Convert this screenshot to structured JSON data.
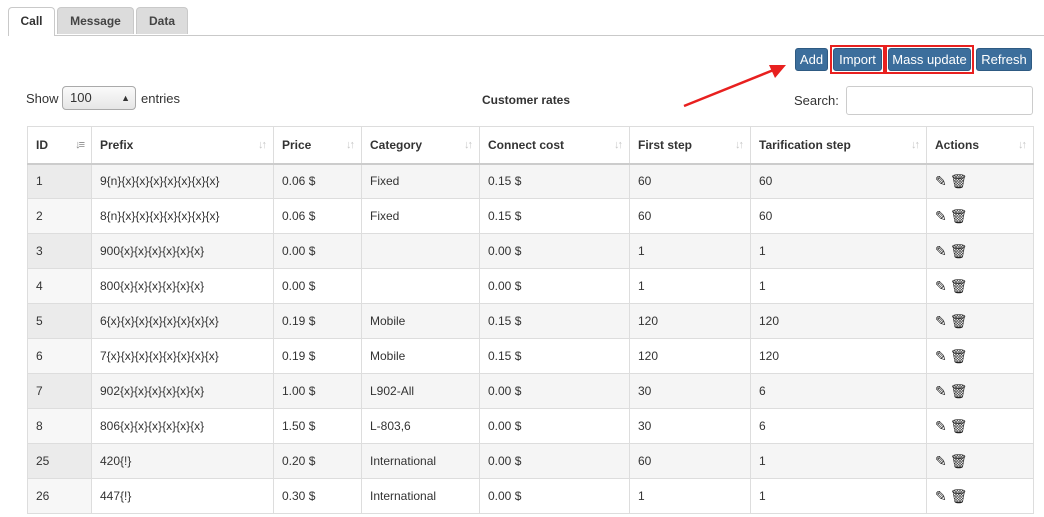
{
  "tabs": [
    {
      "label": "Call",
      "active": true
    },
    {
      "label": "Message",
      "active": false
    },
    {
      "label": "Data",
      "active": false
    }
  ],
  "toolbar": {
    "add_label": "Add",
    "import_label": "Import",
    "mass_update_label": "Mass update",
    "refresh_label": "Refresh",
    "highlight_color": "#e8201f"
  },
  "controls": {
    "show_label": "Show",
    "entries_value": "100",
    "entries_label": "entries",
    "table_title": "Customer rates",
    "search_label": "Search:",
    "search_value": ""
  },
  "table": {
    "columns": [
      "ID",
      "Prefix",
      "Price",
      "Category",
      "Connect cost",
      "First step",
      "Tarification step",
      "Actions"
    ],
    "rows": [
      {
        "id": "1",
        "prefix": "9{n}{x}{x}{x}{x}{x}{x}{x}",
        "price": "0.06 $",
        "category": "Fixed",
        "connect_cost": "0.15 $",
        "first_step": "60",
        "tariff_step": "60"
      },
      {
        "id": "2",
        "prefix": "8{n}{x}{x}{x}{x}{x}{x}{x}",
        "price": "0.06 $",
        "category": "Fixed",
        "connect_cost": "0.15 $",
        "first_step": "60",
        "tariff_step": "60"
      },
      {
        "id": "3",
        "prefix": "900{x}{x}{x}{x}{x}{x}",
        "price": "0.00 $",
        "category": "",
        "connect_cost": "0.00 $",
        "first_step": "1",
        "tariff_step": "1"
      },
      {
        "id": "4",
        "prefix": "800{x}{x}{x}{x}{x}{x}",
        "price": "0.00 $",
        "category": "",
        "connect_cost": "0.00 $",
        "first_step": "1",
        "tariff_step": "1"
      },
      {
        "id": "5",
        "prefix": "6{x}{x}{x}{x}{x}{x}{x}{x}",
        "price": "0.19 $",
        "category": "Mobile",
        "connect_cost": "0.15 $",
        "first_step": "120",
        "tariff_step": "120"
      },
      {
        "id": "6",
        "prefix": "7{x}{x}{x}{x}{x}{x}{x}{x}",
        "price": "0.19 $",
        "category": "Mobile",
        "connect_cost": "0.15 $",
        "first_step": "120",
        "tariff_step": "120"
      },
      {
        "id": "7",
        "prefix": "902{x}{x}{x}{x}{x}{x}",
        "price": "1.00 $",
        "category": "L902-All",
        "connect_cost": "0.00 $",
        "first_step": "30",
        "tariff_step": "6"
      },
      {
        "id": "8",
        "prefix": "806{x}{x}{x}{x}{x}{x}",
        "price": "1.50 $",
        "category": "L-803,6",
        "connect_cost": "0.00 $",
        "first_step": "30",
        "tariff_step": "6"
      },
      {
        "id": "25",
        "prefix": "420{!}",
        "price": "0.20 $",
        "category": "International",
        "connect_cost": "0.00 $",
        "first_step": "60",
        "tariff_step": "1"
      },
      {
        "id": "26",
        "prefix": "447{!}",
        "price": "0.30 $",
        "category": "International",
        "connect_cost": "0.00 $",
        "first_step": "1",
        "tariff_step": "1"
      }
    ],
    "action_icons": [
      "edit-icon",
      "trash-icon"
    ]
  }
}
